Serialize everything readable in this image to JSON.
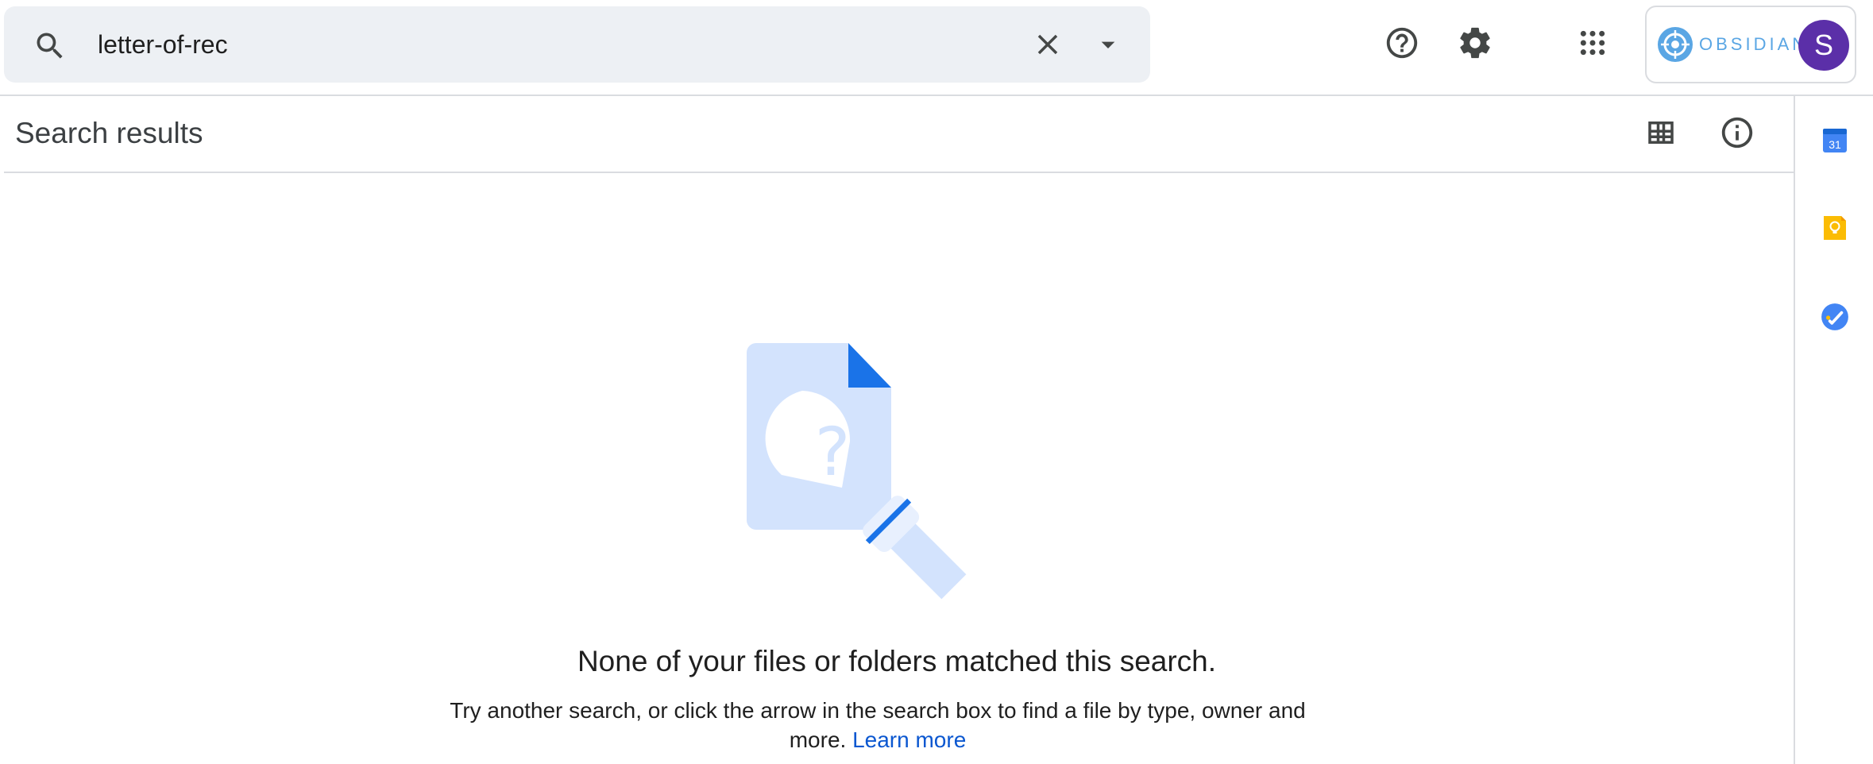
{
  "search": {
    "value": "letter-of-rec"
  },
  "account": {
    "org_name": "OBSIDIAN",
    "avatar_initial": "S",
    "avatar_color": "#5b2fa8"
  },
  "header": {
    "title": "Search results"
  },
  "icons": {
    "search": "search-icon",
    "clear": "close-icon",
    "search_options": "caret-down-icon",
    "help": "help-icon",
    "settings": "gear-icon",
    "apps": "apps-grid-icon",
    "grid_view": "grid-view-icon",
    "details": "info-icon",
    "calendar": "calendar-icon",
    "keep": "keep-icon",
    "tasks": "tasks-icon"
  },
  "side_panel": {
    "calendar_date": "31"
  },
  "empty_state": {
    "title": "None of your files or folders matched this search.",
    "description": "Try another search, or click the arrow in the search box to find a file by type, owner and more.",
    "link": "Learn more"
  },
  "colors": {
    "accent": "#0b57d0",
    "searchbox_bg": "#edf0f4",
    "divider": "#dadce0",
    "illustration_light": "#d3e3fd",
    "illustration_dark": "#1a73e8"
  }
}
